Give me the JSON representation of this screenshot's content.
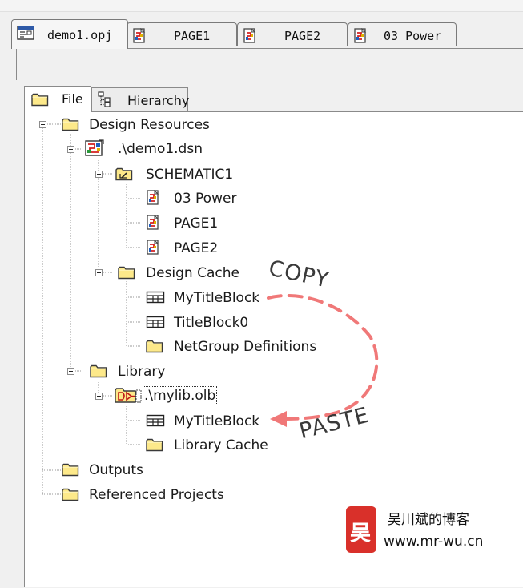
{
  "document_tabs": [
    {
      "label": "demo1.opj",
      "icon": "project-icon",
      "active": true
    },
    {
      "label": "PAGE1",
      "icon": "schematic-page-icon",
      "active": false
    },
    {
      "label": "PAGE2",
      "icon": "schematic-page-icon",
      "active": false
    },
    {
      "label": "03 Power",
      "icon": "schematic-page-icon",
      "active": false
    }
  ],
  "panel_tabs": [
    {
      "label": "File",
      "icon": "folder-icon",
      "active": true
    },
    {
      "label": "Hierarchy",
      "icon": "hierarchy-icon",
      "active": false
    }
  ],
  "tree": {
    "design_resources": "Design Resources",
    "dsn_file": ".\\demo1.dsn",
    "schematic": "SCHEMATIC1",
    "page_03_power": "03 Power",
    "page_1": "PAGE1",
    "page_2": "PAGE2",
    "design_cache": "Design Cache",
    "cache_mytitleblock": "MyTitleBlock",
    "cache_titleblock0": "TitleBlock0",
    "cache_netgroup": "NetGroup Definitions",
    "library": "Library",
    "olb_file": ".\\mylib.olb",
    "lib_mytitleblock": "MyTitleBlock",
    "library_cache": "Library Cache",
    "outputs": "Outputs",
    "referenced_projects": "Referenced Projects"
  },
  "annotations": {
    "copy": "COPY",
    "paste": "PASTE",
    "arrow_color": "#f07878"
  },
  "watermark": {
    "seal_char": "吴",
    "name": "吴川斌的博客",
    "url": "www.mr-wu.cn",
    "seal_color": "#d9302a"
  },
  "colors": {
    "folder_fill": "#fde98a",
    "folder_stroke": "#3a3a3a",
    "tree_background": "#ffffff",
    "window_background": "#f0f0f0"
  }
}
